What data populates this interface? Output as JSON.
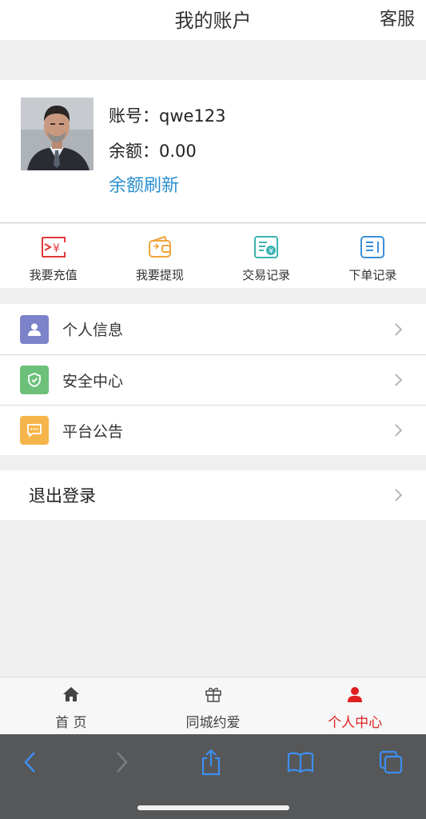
{
  "header": {
    "title": "我的账户",
    "service": "客服"
  },
  "profile": {
    "account_label": "账号：",
    "account_value": "qwe123",
    "balance_label": "余额：",
    "balance_value": "0.00",
    "refresh": "余额刷新"
  },
  "actions": [
    {
      "label": "我要充值",
      "icon": "recharge-icon"
    },
    {
      "label": "我要提现",
      "icon": "wallet-icon"
    },
    {
      "label": "交易记录",
      "icon": "transaction-record-icon"
    },
    {
      "label": "下单记录",
      "icon": "order-record-icon"
    }
  ],
  "menu": [
    {
      "label": "个人信息",
      "icon": "person-icon",
      "color": "#7c83c9"
    },
    {
      "label": "安全中心",
      "icon": "shield-icon",
      "color": "#6cc07a"
    },
    {
      "label": "平台公告",
      "icon": "message-icon",
      "color": "#f5b54a"
    }
  ],
  "logout": {
    "label": "退出登录"
  },
  "tabbar": [
    {
      "label": "首 页",
      "icon": "home-icon",
      "active": false
    },
    {
      "label": "同城约爱",
      "icon": "gift-icon",
      "active": false
    },
    {
      "label": "个人中心",
      "icon": "person-icon",
      "active": true
    }
  ],
  "colors": {
    "accent_red": "#e02020",
    "link_blue": "#2a8fd0",
    "browser_blue": "#3d8ef0"
  }
}
